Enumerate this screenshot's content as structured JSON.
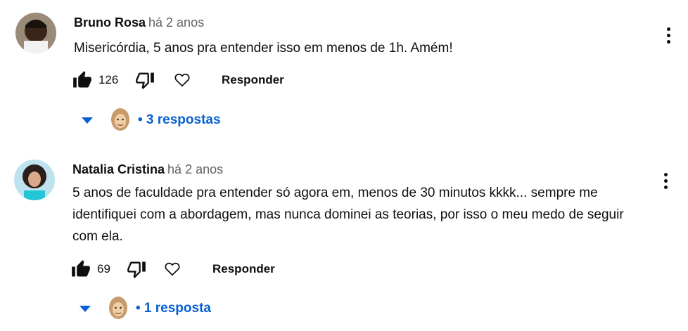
{
  "comments": [
    {
      "author": "Bruno Rosa",
      "time": "há 2 anos",
      "text": "Misericórdia, 5 anos pra entender isso em menos de 1h. Amém!",
      "likes": "126",
      "reply_label": "Responder",
      "replies_text": "• 3 respostas"
    },
    {
      "author": "Natalia Cristina",
      "time": "há 2 anos",
      "text": "5 anos de faculdade pra entender só agora em,  menos de 30 minutos kkkk... sempre me identifiquei com a abordagem, mas nunca dominei as teorias, por isso o meu medo de seguir com ela.",
      "likes": "69",
      "reply_label": "Responder",
      "replies_text": "• 1 resposta"
    }
  ],
  "colors": {
    "link": "#065fd4",
    "text": "#0f0f0f",
    "muted": "#606060"
  },
  "icons": [
    "like-icon",
    "dislike-icon",
    "heart-icon",
    "more-options-icon",
    "chevron-down-icon"
  ]
}
